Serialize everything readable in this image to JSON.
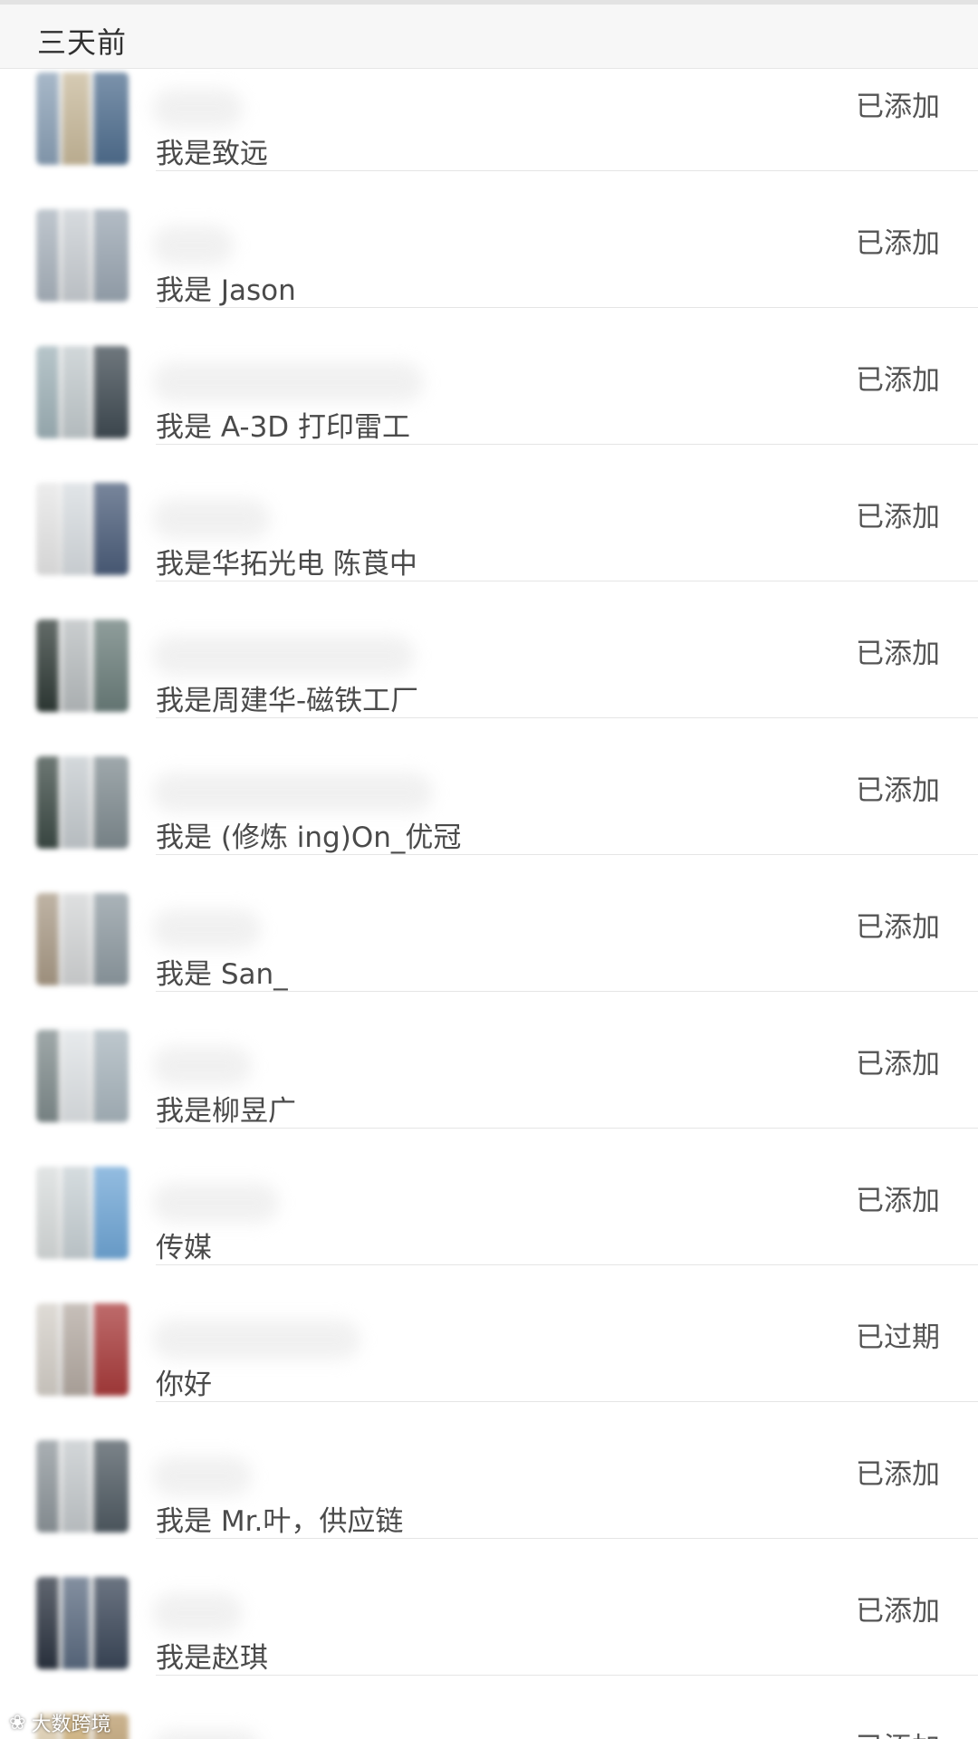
{
  "section_header": "三天前",
  "requests": [
    {
      "message": "我是致远",
      "status": "已添加",
      "avatar_colors": [
        "#8aa0b6",
        "#c8b99a",
        "#4f6e8f"
      ]
    },
    {
      "message": "我是 Jason",
      "status": "已添加",
      "avatar_colors": [
        "#a9b3bd",
        "#c9ced3",
        "#9aa6b2"
      ]
    },
    {
      "message": "我是 A-3D 打印雷工",
      "status": "已添加",
      "avatar_colors": [
        "#9fb2b8",
        "#c2cacd",
        "#3f4a52"
      ]
    },
    {
      "message": "我是华拓光电 陈莨中",
      "status": "已添加",
      "avatar_colors": [
        "#e6e6e6",
        "#d7dce0",
        "#4b5d7a"
      ]
    },
    {
      "message": "我是周建华-磁铁工厂",
      "status": "已添加",
      "avatar_colors": [
        "#2f3a36",
        "#b8bdbf",
        "#6a7d7a"
      ]
    },
    {
      "message": "我是 (修炼 ing)On_优冠",
      "status": "已添加",
      "avatar_colors": [
        "#3c4a45",
        "#c5cbcf",
        "#7f8b90"
      ]
    },
    {
      "message": "我是 San_",
      "status": "已添加",
      "avatar_colors": [
        "#a99a86",
        "#d3d5d6",
        "#8e9aa1"
      ]
    },
    {
      "message": "我是柳昱广",
      "status": "已添加",
      "avatar_colors": [
        "#7f8b8c",
        "#dfe3e6",
        "#a8b5bd"
      ]
    },
    {
      "message": "传媒",
      "status": "已添加",
      "avatar_colors": [
        "#d8dcdc",
        "#c7d0d4",
        "#6fa6d6"
      ]
    },
    {
      "message": "你好",
      "status": "已过期",
      "avatar_colors": [
        "#d4cfc8",
        "#b4aaa2",
        "#a83a3a"
      ]
    },
    {
      "message": "我是 Mr.叶，供应链",
      "status": "已添加",
      "avatar_colors": [
        "#8d959a",
        "#c4c9cc",
        "#4f5a62"
      ]
    },
    {
      "message": "我是赵琪",
      "status": "已添加",
      "avatar_colors": [
        "#2b3340",
        "#5a6a80",
        "#3a4658"
      ]
    },
    {
      "message": "",
      "status": "已添加",
      "avatar_colors": [
        "#d9c8a8",
        "#c9a86e",
        "#b99a6a"
      ]
    }
  ],
  "watermark": {
    "text": "大数跨境",
    "icon": "baidu-paw-icon"
  }
}
